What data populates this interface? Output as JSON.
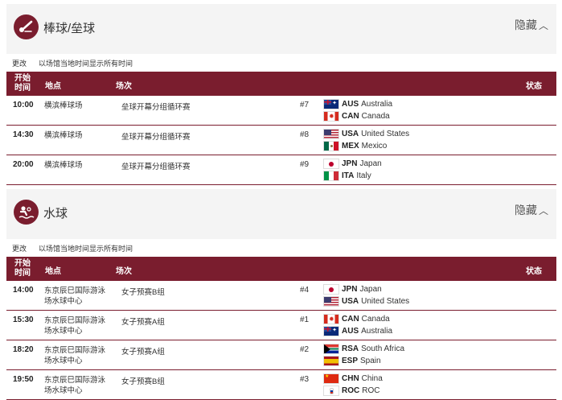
{
  "colors": {
    "brand": "#7a1d2e",
    "header_bg": "#f4f4f4"
  },
  "common": {
    "change_label": "更改",
    "tz_note": "以场馆当地时间显示所有时间",
    "hide_label": "隐藏",
    "columns": {
      "time": "开始时间",
      "venue": "地点",
      "event": "场次",
      "status": "状态"
    }
  },
  "sports": [
    {
      "title": "棒球/垒球",
      "icon": "baseball-icon",
      "rows": [
        {
          "time": "10:00",
          "venue": "横滨棒球场",
          "event": "垒球开幕分组循环赛",
          "number": "#7",
          "teams": [
            {
              "code": "AUS",
              "name": "Australia",
              "flag": "aus"
            },
            {
              "code": "CAN",
              "name": "Canada",
              "flag": "can"
            }
          ]
        },
        {
          "time": "14:30",
          "venue": "横滨棒球场",
          "event": "垒球开幕分组循环赛",
          "number": "#8",
          "teams": [
            {
              "code": "USA",
              "name": "United States",
              "flag": "usa"
            },
            {
              "code": "MEX",
              "name": "Mexico",
              "flag": "mex"
            }
          ]
        },
        {
          "time": "20:00",
          "venue": "横滨棒球场",
          "event": "垒球开幕分组循环赛",
          "number": "#9",
          "teams": [
            {
              "code": "JPN",
              "name": "Japan",
              "flag": "jpn"
            },
            {
              "code": "ITA",
              "name": "Italy",
              "flag": "ita"
            }
          ]
        }
      ]
    },
    {
      "title": "水球",
      "icon": "water-polo-icon",
      "rows": [
        {
          "time": "14:00",
          "venue": "东京辰巳国际游泳场水球中心",
          "event": "女子预赛B组",
          "number": "#4",
          "teams": [
            {
              "code": "JPN",
              "name": "Japan",
              "flag": "jpn"
            },
            {
              "code": "USA",
              "name": "United States",
              "flag": "usa"
            }
          ]
        },
        {
          "time": "15:30",
          "venue": "东京辰巳国际游泳场水球中心",
          "event": "女子预赛A组",
          "number": "#1",
          "teams": [
            {
              "code": "CAN",
              "name": "Canada",
              "flag": "can"
            },
            {
              "code": "AUS",
              "name": "Australia",
              "flag": "aus"
            }
          ]
        },
        {
          "time": "18:20",
          "venue": "东京辰巳国际游泳场水球中心",
          "event": "女子预赛A组",
          "number": "#2",
          "teams": [
            {
              "code": "RSA",
              "name": "South Africa",
              "flag": "rsa"
            },
            {
              "code": "ESP",
              "name": "Spain",
              "flag": "esp"
            }
          ]
        },
        {
          "time": "19:50",
          "venue": "东京辰巳国际游泳场水球中心",
          "event": "女子预赛B组",
          "number": "#3",
          "teams": [
            {
              "code": "CHN",
              "name": "China",
              "flag": "chn"
            },
            {
              "code": "ROC",
              "name": "ROC",
              "flag": "roc"
            }
          ]
        }
      ]
    }
  ]
}
